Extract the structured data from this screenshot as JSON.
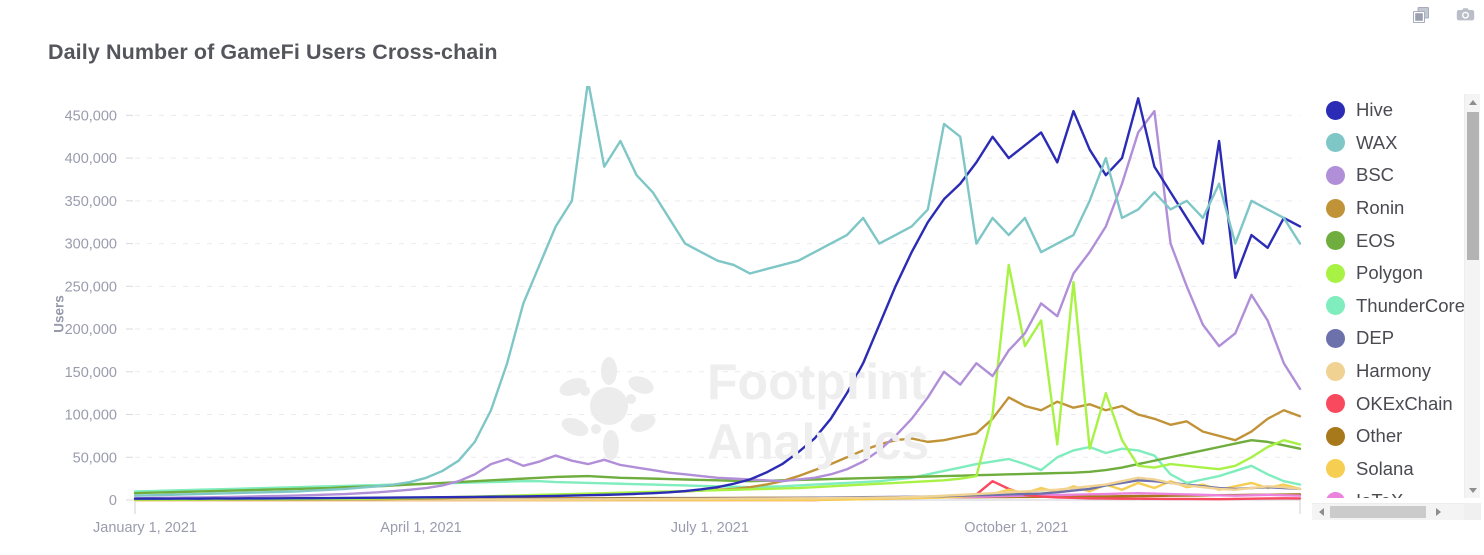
{
  "toolbar": {
    "icons": [
      {
        "name": "copy-icon",
        "label": "Duplicate"
      },
      {
        "name": "camera-icon",
        "label": "Screenshot"
      }
    ]
  },
  "header": {
    "title": "Daily Number of GameFi Users Cross-chain"
  },
  "watermark": {
    "line1": "Footprint",
    "line2": "Analytics"
  },
  "legend": {
    "position": "right",
    "scroll": {
      "vertical": true,
      "horizontal": true
    },
    "items": [
      {
        "label": "Hive",
        "color": "#2b2bb5"
      },
      {
        "label": "WAX",
        "color": "#7fc6c6"
      },
      {
        "label": "BSC",
        "color": "#b18fd8"
      },
      {
        "label": "Ronin",
        "color": "#c19339"
      },
      {
        "label": "EOS",
        "color": "#6fae3e"
      },
      {
        "label": "Polygon",
        "color": "#a8f246"
      },
      {
        "label": "ThunderCore",
        "color": "#7fedbd"
      },
      {
        "label": "DEP",
        "color": "#6d71ab"
      },
      {
        "label": "Harmony",
        "color": "#f0d293"
      },
      {
        "label": "OKExChain",
        "color": "#f9495f"
      },
      {
        "label": "Other",
        "color": "#a8791b"
      },
      {
        "label": "Solana",
        "color": "#f5ce52"
      },
      {
        "label": "IoTeX",
        "color": "#eb83dd"
      }
    ]
  },
  "chart_data": {
    "type": "line",
    "title": "Daily Number of GameFi Users Cross-chain",
    "xlabel": "",
    "ylabel": "Users",
    "ylim": [
      0,
      475000
    ],
    "yticks": [
      0,
      50000,
      100000,
      150000,
      200000,
      250000,
      300000,
      350000,
      400000,
      450000
    ],
    "ytick_labels": [
      "0",
      "50,000",
      "100,000",
      "150,000",
      "200,000",
      "250,000",
      "300,000",
      "350,000",
      "400,000",
      "450,000"
    ],
    "grid": true,
    "xtick_labels": [
      "January 1, 2021",
      "April 1, 2021",
      "July 1, 2021",
      "October 1, 2021"
    ],
    "xtick_positions": [
      0,
      0.2466,
      0.4959,
      0.7479
    ],
    "x_range": [
      "January 1, 2021",
      "December 2021"
    ],
    "n_points": 73,
    "series": [
      {
        "name": "Hive",
        "color": "#2b2bb5",
        "values": [
          1500,
          1600,
          1500,
          1700,
          1600,
          1800,
          1700,
          1900,
          1800,
          2000,
          2100,
          2200,
          2300,
          2400,
          2600,
          2700,
          2900,
          3000,
          3100,
          3300,
          3400,
          3600,
          3800,
          4000,
          4200,
          4500,
          4800,
          5200,
          5600,
          6000,
          6500,
          7200,
          8000,
          9000,
          10500,
          12500,
          15000,
          19000,
          24000,
          32000,
          42000,
          56000,
          72000,
          95000,
          125000,
          160000,
          205000,
          250000,
          290000,
          325000,
          352000,
          370000,
          395000,
          425000,
          400000,
          415000,
          430000,
          395000,
          455000,
          410000,
          380000,
          400000,
          470000,
          390000,
          360000,
          330000,
          300000,
          420000,
          260000,
          310000,
          295000,
          330000,
          320000
        ]
      },
      {
        "name": "WAX",
        "color": "#7fc6c6",
        "values": [
          5000,
          5500,
          6000,
          6500,
          7000,
          7500,
          8000,
          8500,
          9000,
          9500,
          10000,
          11000,
          12000,
          13000,
          14500,
          16000,
          18000,
          21000,
          26000,
          34000,
          46000,
          68000,
          105000,
          160000,
          230000,
          275000,
          320000,
          350000,
          490000,
          390000,
          420000,
          380000,
          360000,
          330000,
          300000,
          290000,
          280000,
          275000,
          265000,
          270000,
          275000,
          280000,
          290000,
          300000,
          310000,
          330000,
          300000,
          310000,
          320000,
          340000,
          440000,
          425000,
          300000,
          330000,
          310000,
          330000,
          290000,
          300000,
          310000,
          350000,
          400000,
          330000,
          340000,
          360000,
          340000,
          350000,
          330000,
          370000,
          300000,
          350000,
          340000,
          330000,
          300000
        ]
      },
      {
        "name": "BSC",
        "color": "#b18fd8",
        "values": [
          2000,
          2200,
          2500,
          2800,
          3000,
          3300,
          3600,
          4000,
          4400,
          4800,
          5200,
          5800,
          6400,
          7000,
          8000,
          9000,
          10500,
          12000,
          14000,
          17000,
          22000,
          30000,
          42000,
          48000,
          40000,
          45000,
          52000,
          46000,
          42000,
          47000,
          41000,
          38000,
          35000,
          32000,
          30000,
          28000,
          26000,
          25000,
          24000,
          23000,
          22000,
          24000,
          26000,
          30000,
          36000,
          45000,
          58000,
          75000,
          95000,
          120000,
          150000,
          135000,
          160000,
          145000,
          175000,
          195000,
          230000,
          215000,
          265000,
          290000,
          320000,
          370000,
          430000,
          455000,
          300000,
          250000,
          205000,
          180000,
          195000,
          240000,
          210000,
          160000,
          130000
        ]
      },
      {
        "name": "Ronin",
        "color": "#c19339",
        "values": [
          300,
          300,
          350,
          350,
          400,
          400,
          450,
          500,
          500,
          550,
          600,
          650,
          700,
          800,
          900,
          1000,
          1200,
          1400,
          1700,
          2000,
          2500,
          3000,
          3800,
          4500,
          5000,
          5500,
          6000,
          6500,
          7000,
          7500,
          8000,
          8500,
          9000,
          9500,
          10000,
          11000,
          12000,
          13000,
          15000,
          18000,
          22000,
          28000,
          35000,
          42000,
          50000,
          58000,
          65000,
          70000,
          72000,
          68000,
          70000,
          74000,
          78000,
          95000,
          120000,
          110000,
          105000,
          115000,
          108000,
          112000,
          105000,
          110000,
          100000,
          95000,
          88000,
          92000,
          80000,
          75000,
          70000,
          80000,
          95000,
          105000,
          98000
        ]
      },
      {
        "name": "EOS",
        "color": "#6fae3e",
        "values": [
          8000,
          8500,
          9000,
          9500,
          10000,
          10500,
          11000,
          11500,
          12000,
          12500,
          13000,
          13500,
          14000,
          15000,
          15500,
          16000,
          17000,
          18000,
          19000,
          20000,
          21000,
          22000,
          23000,
          24000,
          25000,
          26000,
          27000,
          27500,
          28000,
          27000,
          26000,
          25500,
          25000,
          24500,
          24000,
          23500,
          23000,
          22500,
          22000,
          22500,
          23000,
          23500,
          24000,
          24500,
          25000,
          25500,
          26000,
          26500,
          27000,
          27500,
          28000,
          28500,
          29000,
          29500,
          30000,
          30500,
          31000,
          31500,
          32000,
          33000,
          35000,
          38000,
          42000,
          46000,
          50000,
          54000,
          58000,
          62000,
          66000,
          70000,
          68000,
          64000,
          60000
        ]
      },
      {
        "name": "Polygon",
        "color": "#a8f246",
        "values": [
          500,
          500,
          600,
          600,
          700,
          700,
          800,
          900,
          900,
          1000,
          1100,
          1200,
          1300,
          1400,
          1600,
          1800,
          2000,
          2300,
          2600,
          3000,
          3500,
          4000,
          4500,
          5000,
          5500,
          6000,
          6500,
          7000,
          7500,
          8000,
          8500,
          9000,
          9500,
          10000,
          10500,
          11000,
          11500,
          12000,
          12500,
          13000,
          13500,
          14000,
          15000,
          16000,
          17000,
          18000,
          19000,
          20000,
          21000,
          22000,
          23000,
          25000,
          28000,
          100000,
          275000,
          180000,
          210000,
          65000,
          255000,
          60000,
          125000,
          70000,
          40000,
          38000,
          42000,
          40000,
          38000,
          36000,
          40000,
          50000,
          62000,
          70000,
          65000
        ]
      },
      {
        "name": "ThunderCore",
        "color": "#7fedbd",
        "values": [
          10000,
          10500,
          11000,
          11500,
          12000,
          12500,
          13000,
          13500,
          14000,
          14500,
          15000,
          15500,
          16000,
          16500,
          17000,
          17500,
          18000,
          18500,
          19000,
          19500,
          20000,
          20500,
          21000,
          21500,
          22000,
          22000,
          21000,
          20500,
          20000,
          19500,
          19000,
          18500,
          18000,
          17500,
          17000,
          16500,
          16000,
          15500,
          15000,
          15500,
          16000,
          17000,
          18000,
          19000,
          20000,
          21000,
          22000,
          24000,
          26000,
          30000,
          34000,
          38000,
          42000,
          45000,
          48000,
          42000,
          35000,
          50000,
          58000,
          62000,
          55000,
          60000,
          58000,
          52000,
          30000,
          20000,
          24000,
          28000,
          34000,
          40000,
          30000,
          22000,
          18000
        ]
      },
      {
        "name": "DEP",
        "color": "#6d71ab",
        "values": [
          200,
          200,
          200,
          250,
          250,
          250,
          300,
          300,
          300,
          350,
          350,
          400,
          400,
          450,
          450,
          500,
          500,
          550,
          600,
          600,
          650,
          700,
          700,
          750,
          800,
          850,
          900,
          950,
          1000,
          1100,
          1200,
          1300,
          1400,
          1500,
          1600,
          1700,
          1800,
          1900,
          2000,
          2100,
          2200,
          2400,
          2600,
          2800,
          3000,
          3200,
          3400,
          3600,
          3800,
          4000,
          4500,
          5000,
          5500,
          6000,
          6500,
          7000,
          7500,
          9000,
          11000,
          13000,
          17000,
          20000,
          23000,
          22000,
          20000,
          18000,
          16000,
          14000,
          13000,
          14000,
          15000,
          14000,
          13000
        ]
      },
      {
        "name": "Harmony",
        "color": "#f0d293",
        "values": [
          100,
          100,
          100,
          150,
          150,
          150,
          200,
          200,
          200,
          250,
          250,
          250,
          300,
          300,
          350,
          350,
          400,
          400,
          450,
          450,
          500,
          500,
          550,
          600,
          600,
          650,
          700,
          750,
          800,
          850,
          900,
          950,
          1000,
          1100,
          1200,
          1300,
          1400,
          1500,
          1600,
          1700,
          1800,
          1900,
          2000,
          2200,
          2400,
          2600,
          2800,
          3000,
          3500,
          4000,
          5000,
          6000,
          7000,
          8000,
          9000,
          10000,
          11000,
          12000,
          14000,
          16000,
          18000,
          22000,
          26000,
          24000,
          20000,
          17000,
          15000,
          13000,
          12000,
          14000,
          16000,
          15000,
          13000
        ]
      },
      {
        "name": "OKExChain",
        "color": "#f9495f",
        "values": [
          0,
          0,
          0,
          0,
          0,
          0,
          0,
          0,
          0,
          0,
          0,
          0,
          0,
          0,
          0,
          0,
          0,
          0,
          0,
          0,
          0,
          0,
          0,
          0,
          0,
          0,
          0,
          0,
          0,
          0,
          0,
          0,
          0,
          0,
          0,
          0,
          0,
          0,
          0,
          0,
          0,
          0,
          0,
          500,
          800,
          1200,
          1500,
          2000,
          2500,
          3000,
          4000,
          5000,
          6500,
          22000,
          13000,
          6000,
          4000,
          3000,
          2500,
          2000,
          1800,
          1600,
          1500,
          1400,
          1300,
          1200,
          1100,
          1000,
          1200,
          1500,
          1800,
          2000,
          1800
        ]
      },
      {
        "name": "Other",
        "color": "#a8791b",
        "values": [
          600,
          600,
          700,
          700,
          800,
          800,
          900,
          900,
          1000,
          1000,
          1100,
          1100,
          1200,
          1200,
          1300,
          1300,
          1400,
          1400,
          1500,
          1500,
          1600,
          1600,
          1700,
          1700,
          1800,
          1800,
          1900,
          1900,
          2000,
          2000,
          2100,
          2100,
          2200,
          2200,
          2300,
          2300,
          2400,
          2400,
          2500,
          2500,
          2600,
          2600,
          2700,
          2700,
          2800,
          2800,
          2900,
          2900,
          3000,
          3000,
          3100,
          3200,
          3300,
          3400,
          3500,
          3600,
          3700,
          3800,
          3900,
          4000,
          4200,
          4400,
          4600,
          4800,
          5000,
          5200,
          5400,
          5600,
          5800,
          6000,
          6200,
          6400,
          6600
        ]
      },
      {
        "name": "Solana",
        "color": "#f5ce52",
        "values": [
          0,
          0,
          0,
          0,
          0,
          0,
          0,
          0,
          0,
          0,
          0,
          0,
          0,
          0,
          0,
          0,
          0,
          0,
          0,
          0,
          0,
          0,
          0,
          0,
          0,
          0,
          0,
          0,
          0,
          0,
          0,
          0,
          0,
          0,
          0,
          0,
          0,
          0,
          0,
          0,
          0,
          0,
          200,
          400,
          600,
          1000,
          1400,
          1800,
          2200,
          2600,
          3000,
          4000,
          5000,
          7000,
          12000,
          8000,
          14000,
          9000,
          16000,
          10000,
          18000,
          12000,
          20000,
          14000,
          22000,
          15000,
          18000,
          12000,
          16000,
          20000,
          14000,
          18000,
          13000
        ]
      },
      {
        "name": "IoTeX",
        "color": "#eb83dd",
        "values": [
          50,
          50,
          50,
          80,
          80,
          80,
          100,
          100,
          100,
          150,
          150,
          150,
          200,
          200,
          200,
          250,
          250,
          300,
          300,
          350,
          350,
          400,
          400,
          450,
          500,
          500,
          550,
          600,
          650,
          700,
          750,
          800,
          850,
          900,
          950,
          1000,
          1100,
          1200,
          1300,
          1400,
          1500,
          1600,
          1700,
          1800,
          2000,
          2200,
          2400,
          2600,
          2800,
          3000,
          3200,
          3500,
          3800,
          4200,
          4600,
          5000,
          5400,
          5800,
          6200,
          6600,
          7000,
          7500,
          8000,
          7500,
          7000,
          6500,
          6000,
          5500,
          5000,
          5500,
          6000,
          5500,
          5000
        ]
      }
    ]
  }
}
